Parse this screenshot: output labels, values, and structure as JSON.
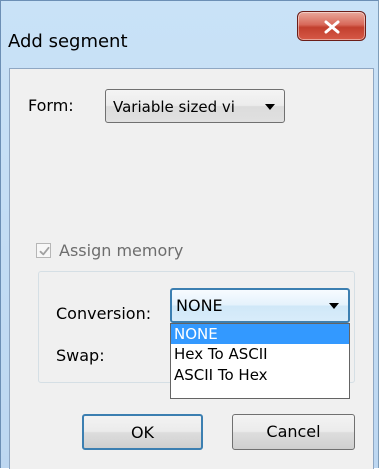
{
  "window": {
    "title": "Add segment",
    "close_label": "X"
  },
  "form": {
    "label": "Form:",
    "selected_value": "Variable sized vi"
  },
  "assign_memory": {
    "label": "Assign memory",
    "checked": true,
    "enabled": false
  },
  "conversion": {
    "label": "Conversion:",
    "selected_value": "NONE",
    "options": [
      "NONE",
      "Hex To ASCII",
      "ASCII To Hex"
    ],
    "highlighted_index": 0
  },
  "swap": {
    "label": "Swap:"
  },
  "buttons": {
    "ok_label": "OK",
    "cancel_label": "Cancel"
  },
  "colors": {
    "selection_highlight": "#3399ff",
    "focus_border": "#3c7fb1",
    "disabled_text": "#6d6d6d"
  }
}
